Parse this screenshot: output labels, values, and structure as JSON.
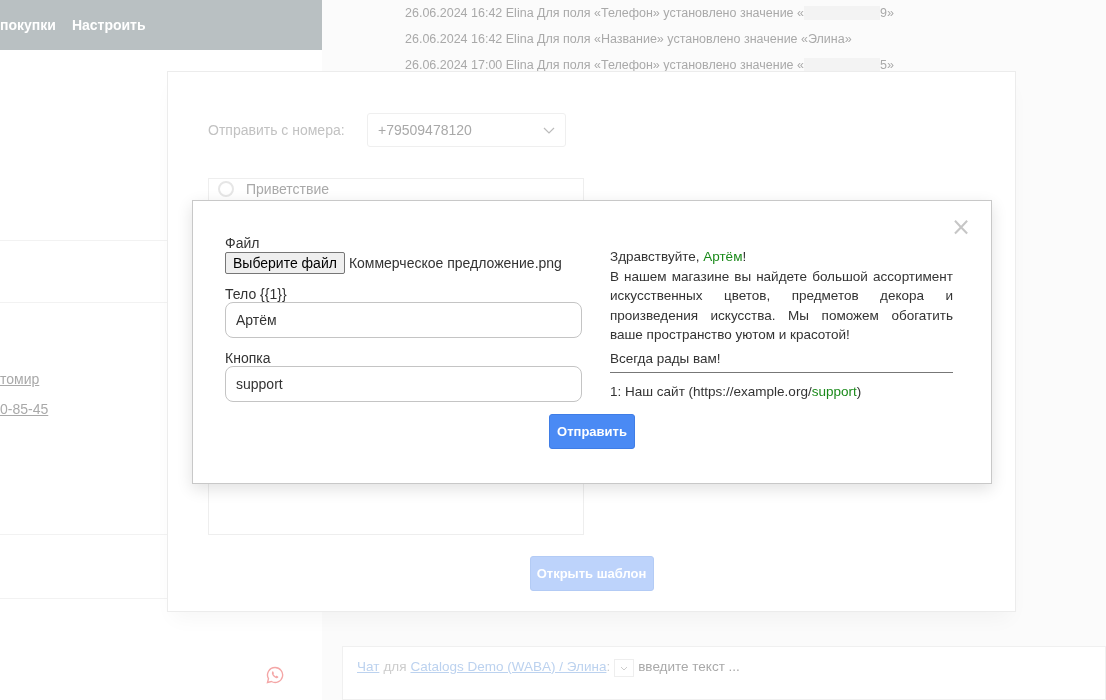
{
  "background": {
    "nav": [
      {
        "label": "покупки"
      },
      {
        "label": "Настроить"
      }
    ],
    "contact_links": [
      "томир",
      "0-85-45"
    ],
    "history": [
      {
        "prefix": "26.06.2024 16:42 Elina Для поля «Телефон» установлено значение «",
        "redacted": true,
        "suffix": "9»"
      },
      {
        "prefix": "26.06.2024 16:42 Elina Для поля «Название» установлено значение «Элина»",
        "redacted": false
      },
      {
        "prefix": "26.06.2024 17:00 Elina Для поля «Телефон» установлено значение «",
        "redacted": true,
        "suffix": "5»"
      }
    ],
    "chat_bar": {
      "chat_link": "Чат",
      "for": "для",
      "contact_link": "Catalogs Demo (WABA) / Элина",
      "colon": ":",
      "placeholder": "введите текст ..."
    }
  },
  "send_dialog": {
    "from_label": "Отправить с номера:",
    "from_value": "+79509478120",
    "templates": [
      {
        "label": "Приветствие",
        "selected": false
      }
    ],
    "open_button": {
      "label": "Открыть шаблон",
      "disabled": true
    }
  },
  "template_modal": {
    "file_label": "Файл",
    "file_button": "Выберите файл",
    "file_name": "Коммерческое предложение.png",
    "fields": [
      {
        "label": "Тело {{1}}",
        "value": "Артём"
      },
      {
        "label": "Кнопка",
        "value": "support"
      }
    ],
    "send_button": "Отправить",
    "close": "×",
    "preview": {
      "greeting": [
        {
          "kind": "text",
          "text": "Здравствуйте, "
        },
        {
          "kind": "variable",
          "text": "Артём"
        },
        {
          "kind": "text",
          "text": "!"
        }
      ],
      "body": "В нашем магазине вы найдете большой ассортимент искусственных цветов, предметов декора и произведения искусства. Мы поможем обогатить ваше пространство уютом и красотой!",
      "footer": "Всегда рады вам!",
      "buttons": [
        [
          {
            "kind": "text",
            "text": "1: Наш сайт (https://example.org/"
          },
          {
            "kind": "variable",
            "text": "support"
          },
          {
            "kind": "text",
            "text": ")"
          }
        ]
      ]
    }
  }
}
